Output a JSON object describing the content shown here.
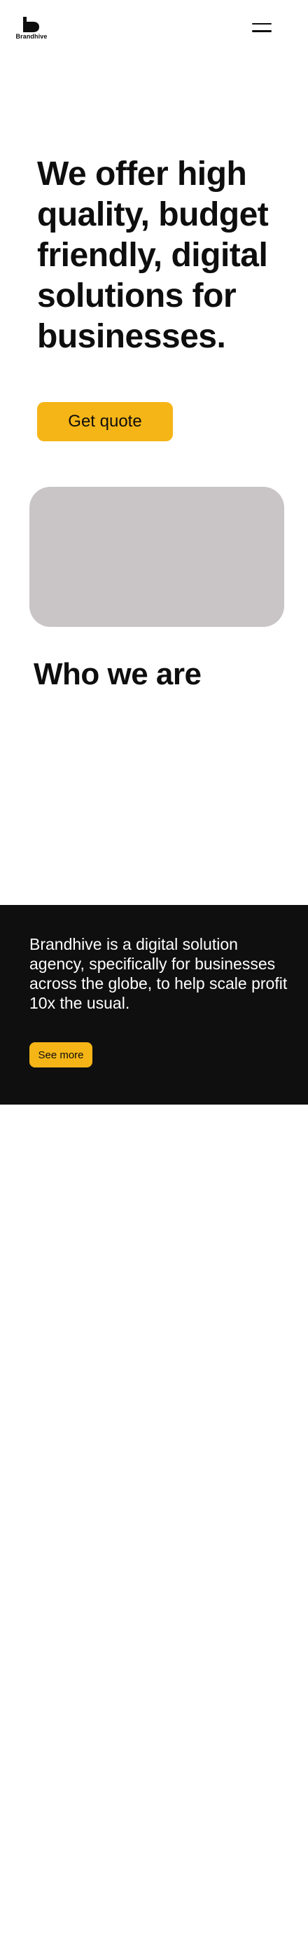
{
  "header": {
    "brand_name": "Brandhive",
    "logo_icon": "brandhive-logo-mark",
    "menu_icon": "hamburger-menu-icon"
  },
  "hero": {
    "title": "We offer high quality, budget friendly, digital solutions for businesses.",
    "cta_label": "Get quote"
  },
  "who_we_are": {
    "title": "Who we are"
  },
  "about": {
    "text": "Brandhive is a digital solution agency, specifically for businesses across the globe, to help scale profit 10x the usual.",
    "button_label": "See more"
  },
  "colors": {
    "accent": "#f5b517",
    "dark": "#0f0f0f",
    "text": "#0e0e0e",
    "image_placeholder": "#c9c5c6",
    "background": "#ffffff"
  }
}
